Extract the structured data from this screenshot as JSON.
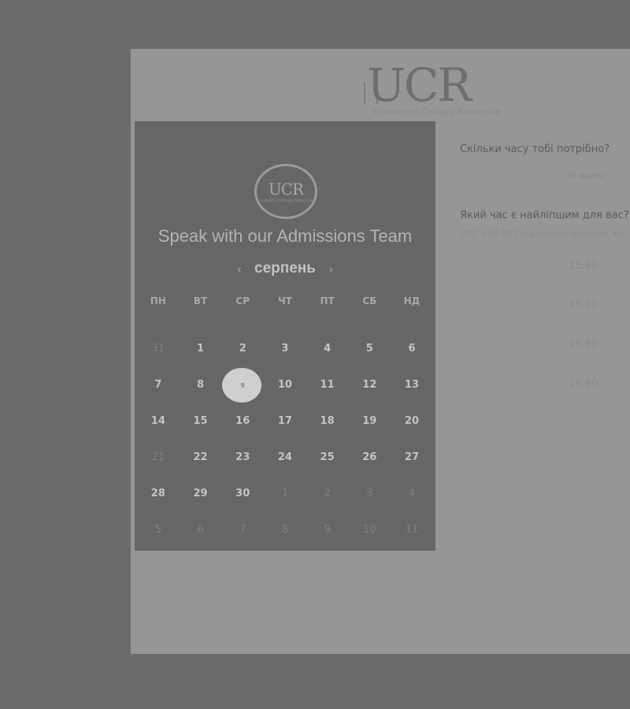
{
  "brand": {
    "logo_text": "UCR",
    "tagline": "University College Rotterdam"
  },
  "calendar": {
    "logo_text": "UCR",
    "logo_subtext": "University College Rotterdam",
    "title": "Speak with our Admissions Team",
    "prev_icon": "‹",
    "next_icon": "›",
    "month": "серпень",
    "weekdays": [
      "ПН",
      "ВТ",
      "СР",
      "ЧТ",
      "ПТ",
      "СБ",
      "НД"
    ],
    "weeks": [
      [
        {
          "d": "31",
          "muted": true
        },
        {
          "d": "1"
        },
        {
          "d": "2"
        },
        {
          "d": "3"
        },
        {
          "d": "4"
        },
        {
          "d": "5"
        },
        {
          "d": "6"
        }
      ],
      [
        {
          "d": "7"
        },
        {
          "d": "8"
        },
        {
          "d": "9",
          "selected": true
        },
        {
          "d": "10"
        },
        {
          "d": "11"
        },
        {
          "d": "12"
        },
        {
          "d": "13"
        }
      ],
      [
        {
          "d": "14"
        },
        {
          "d": "15"
        },
        {
          "d": "16"
        },
        {
          "d": "17"
        },
        {
          "d": "18"
        },
        {
          "d": "19"
        },
        {
          "d": "20"
        }
      ],
      [
        {
          "d": "21",
          "muted": true
        },
        {
          "d": "22"
        },
        {
          "d": "23"
        },
        {
          "d": "24"
        },
        {
          "d": "25"
        },
        {
          "d": "26"
        },
        {
          "d": "27"
        }
      ],
      [
        {
          "d": "28"
        },
        {
          "d": "29"
        },
        {
          "d": "30"
        },
        {
          "d": "1",
          "muted": true
        },
        {
          "d": "2",
          "muted": true
        },
        {
          "d": "3",
          "muted": true
        },
        {
          "d": "4",
          "muted": true
        }
      ],
      [
        {
          "d": "5",
          "muted": true
        },
        {
          "d": "6",
          "muted": true
        },
        {
          "d": "7",
          "muted": true
        },
        {
          "d": "8",
          "muted": true
        },
        {
          "d": "9",
          "muted": true
        },
        {
          "d": "10",
          "muted": true
        },
        {
          "d": "11",
          "muted": true
        }
      ]
    ]
  },
  "booking": {
    "duration_question": "Скільки часу тобі потрібно?",
    "duration_value": "30 хвилин",
    "time_question": "Який час є найліпшим для вас?",
    "timezone": "UTC +03:00 Східноєвропейський час",
    "slots": [
      "15:00",
      "15:30",
      "16:00",
      "16:30"
    ]
  }
}
